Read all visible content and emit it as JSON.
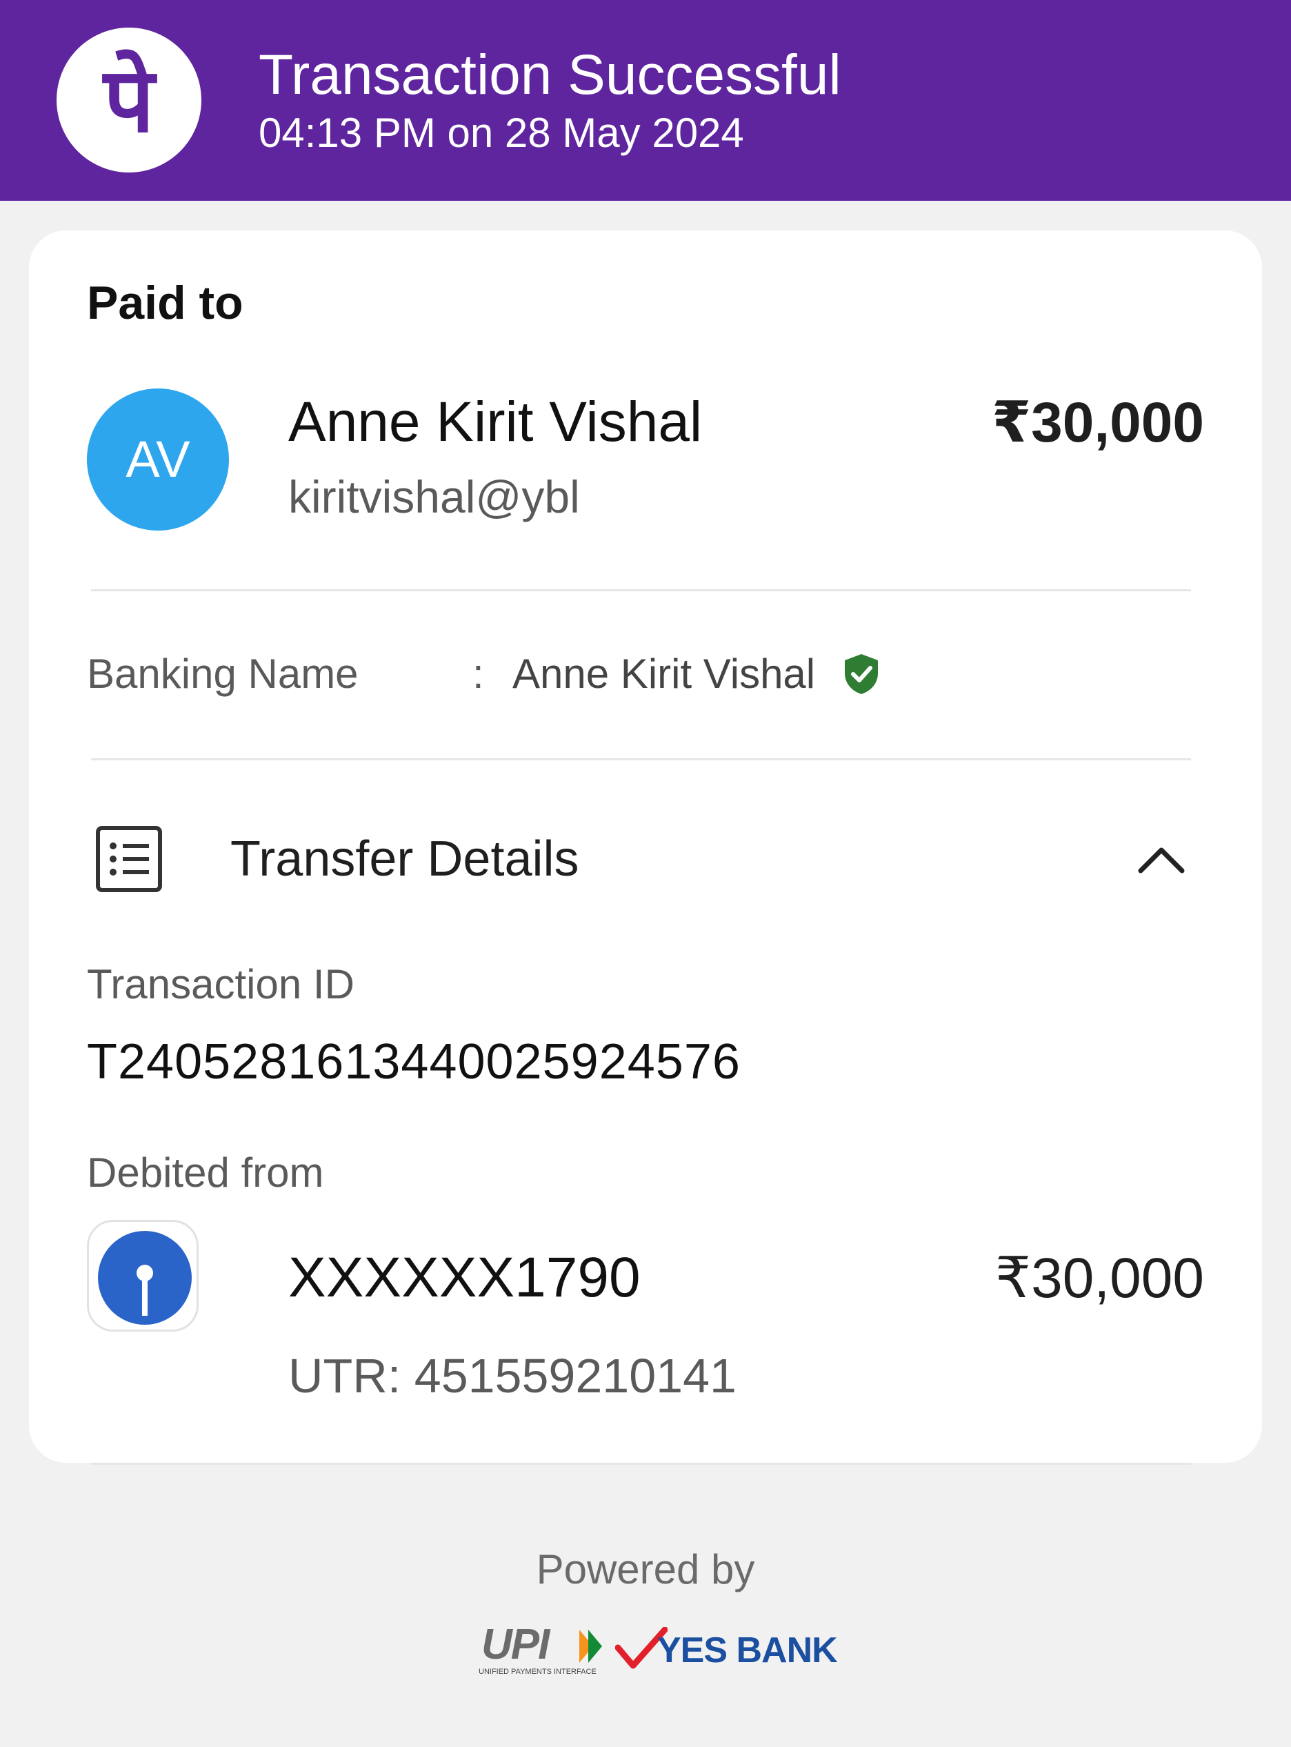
{
  "header": {
    "title": "Transaction Successful",
    "datetime": "04:13 PM on 28 May 2024",
    "logo_icon": "phonepe-logo",
    "logo_text": "पे",
    "bg_color": "#5f259f"
  },
  "paid_to": {
    "label": "Paid to",
    "avatar_initials": "AV",
    "avatar_color": "#2ea6ee",
    "name": "Anne Kirit Vishal",
    "upi_id": "kiritvishal@ybl",
    "amount": "₹30,000"
  },
  "banking_name": {
    "label": "Banking Name",
    "separator": ":",
    "value": "Anne Kirit Vishal",
    "badge_icon": "verified-shield-icon",
    "badge_color": "#2e7d32"
  },
  "transfer_details": {
    "icon": "receipt-list-icon",
    "title": "Transfer Details",
    "toggle_icon": "chevron-up-icon",
    "transaction_id_label": "Transaction ID",
    "transaction_id": "T2405281613440025924576",
    "debited_label": "Debited from",
    "bank_icon": "sbi-logo",
    "account": "XXXXXX1790",
    "amount": "₹30,000",
    "utr": "UTR: 451559210141"
  },
  "footer": {
    "powered_by": "Powered by",
    "upi_logo": "upi-logo",
    "upi_logo_text": "UPI",
    "upi_logo_subtext": "UNIFIED PAYMENTS INTERFACE",
    "bank_name": "YES BANK"
  }
}
